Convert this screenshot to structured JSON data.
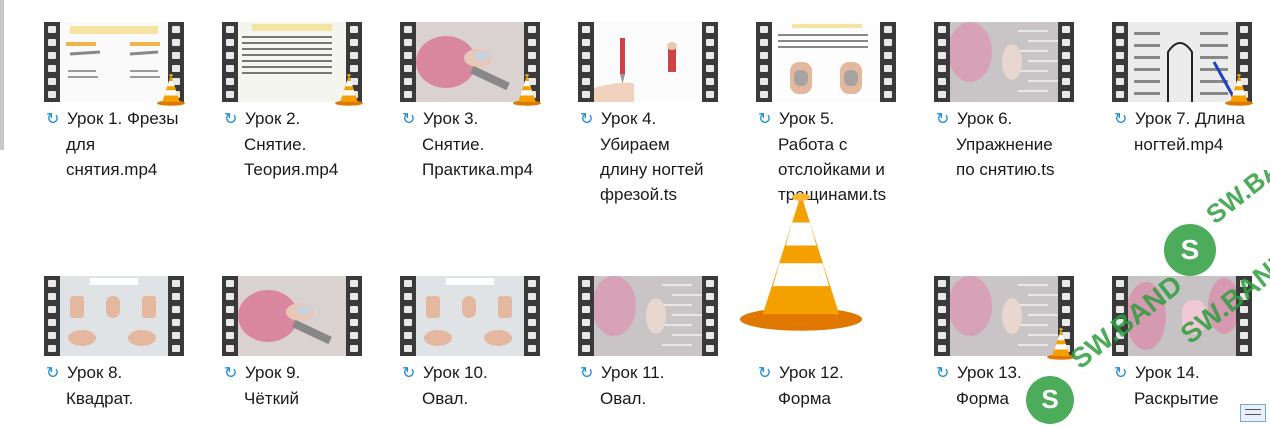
{
  "files": [
    {
      "line1": "Урок 1. Фрезы",
      "rest": [
        "для",
        "снятия.mp4"
      ],
      "theme": "slide",
      "vlc": true
    },
    {
      "line1": "Урок 2.",
      "rest": [
        "Снятие.",
        "Теория.mp4"
      ],
      "theme": "text",
      "vlc": true
    },
    {
      "line1": "Урок 3.",
      "rest": [
        "Снятие.",
        "Практика.mp4"
      ],
      "theme": "hand",
      "vlc": true
    },
    {
      "line1": "Урок 4.",
      "rest": [
        "Убираем",
        "длину ногтей",
        "фрезой.ts"
      ],
      "theme": "drill",
      "vlc": false
    },
    {
      "line1": "Урок 5.",
      "rest": [
        "Работа с",
        "отслойками и",
        "трещинами.ts"
      ],
      "theme": "nails",
      "vlc": false
    },
    {
      "line1": "Урок 6.",
      "rest": [
        "Упражнение",
        "по снятию.ts"
      ],
      "theme": "practice",
      "vlc": false
    },
    {
      "line1": "Урок 7. Длина",
      "rest": [
        "ногтей.mp4"
      ],
      "theme": "diagram",
      "vlc": true
    },
    {
      "line1": "Урок 8.",
      "rest": [
        "Квадрат."
      ],
      "theme": "shapes",
      "vlc": false
    },
    {
      "line1": "Урок 9.",
      "rest": [
        "Чёткий"
      ],
      "theme": "hand",
      "vlc": false
    },
    {
      "line1": "Урок 10.",
      "rest": [
        "Овал."
      ],
      "theme": "shapes",
      "vlc": false
    },
    {
      "line1": "Урок 11.",
      "rest": [
        "Овал."
      ],
      "theme": "practice",
      "vlc": false
    },
    {
      "line1": "Урок 12.",
      "rest": [
        "Форма"
      ],
      "theme": "bigcone",
      "vlc": false
    },
    {
      "line1": "Урок 13.",
      "rest": [
        "Форма"
      ],
      "theme": "practice",
      "vlc": true
    },
    {
      "line1": "Урок 14.",
      "rest": [
        "Раскрытие"
      ],
      "theme": "pink",
      "vlc": false
    }
  ],
  "icons": {
    "sync": "sync-icon",
    "vlc": "vlc-cone-icon",
    "watermark": "watermark-logo"
  },
  "watermark_text": "SW.BAND",
  "colors": {
    "sync": "#1a8fd6",
    "film": "#3a3a3a",
    "cone_orange": "#f08a00",
    "watermark": "#2e9e3f"
  }
}
